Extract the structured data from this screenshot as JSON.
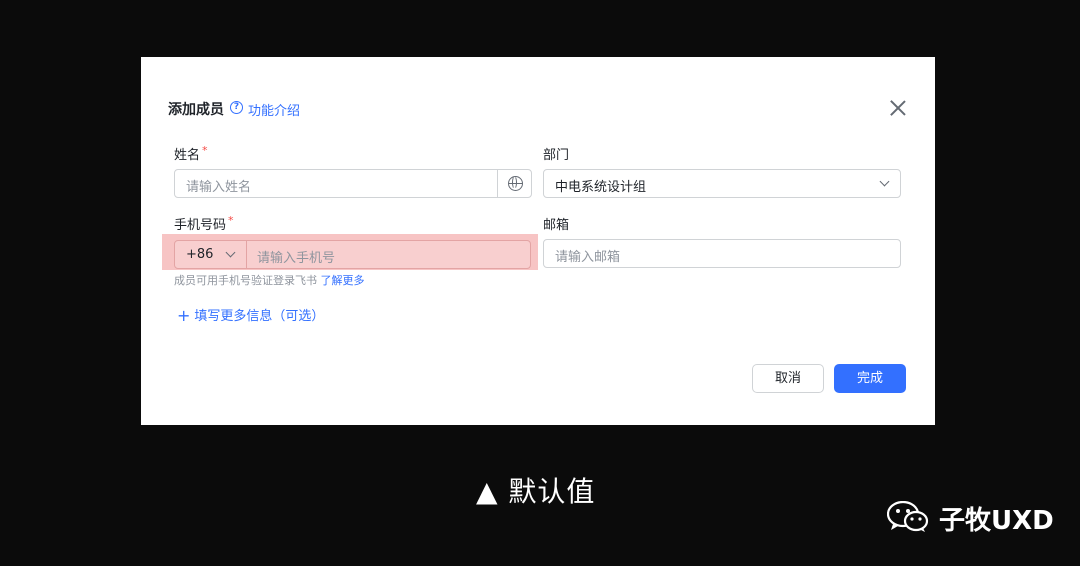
{
  "dialog": {
    "title": "添加成员",
    "help_link": "功能介绍",
    "name_label": "姓名",
    "name_required": "*",
    "name_placeholder": "请输入姓名",
    "dept_label": "部门",
    "dept_value": "中电系统设计组",
    "phone_label": "手机号码",
    "phone_required": "*",
    "country_code": "+86",
    "phone_placeholder": "请输入手机号",
    "email_label": "邮箱",
    "email_placeholder": "请输入邮箱",
    "hint_text": "成员可用手机号验证登录飞书 ",
    "hint_link": "了解更多",
    "more_info": "填写更多信息（可选）",
    "more_info_icon": "+",
    "cancel_label": "取消",
    "done_label": "完成",
    "help_icon_glyph": "?"
  },
  "caption": "▲ 默认值",
  "brand": "子牧UXD",
  "colors": {
    "accent": "#3370ff",
    "required": "#f54a45",
    "highlight": "#f7c4c4"
  }
}
